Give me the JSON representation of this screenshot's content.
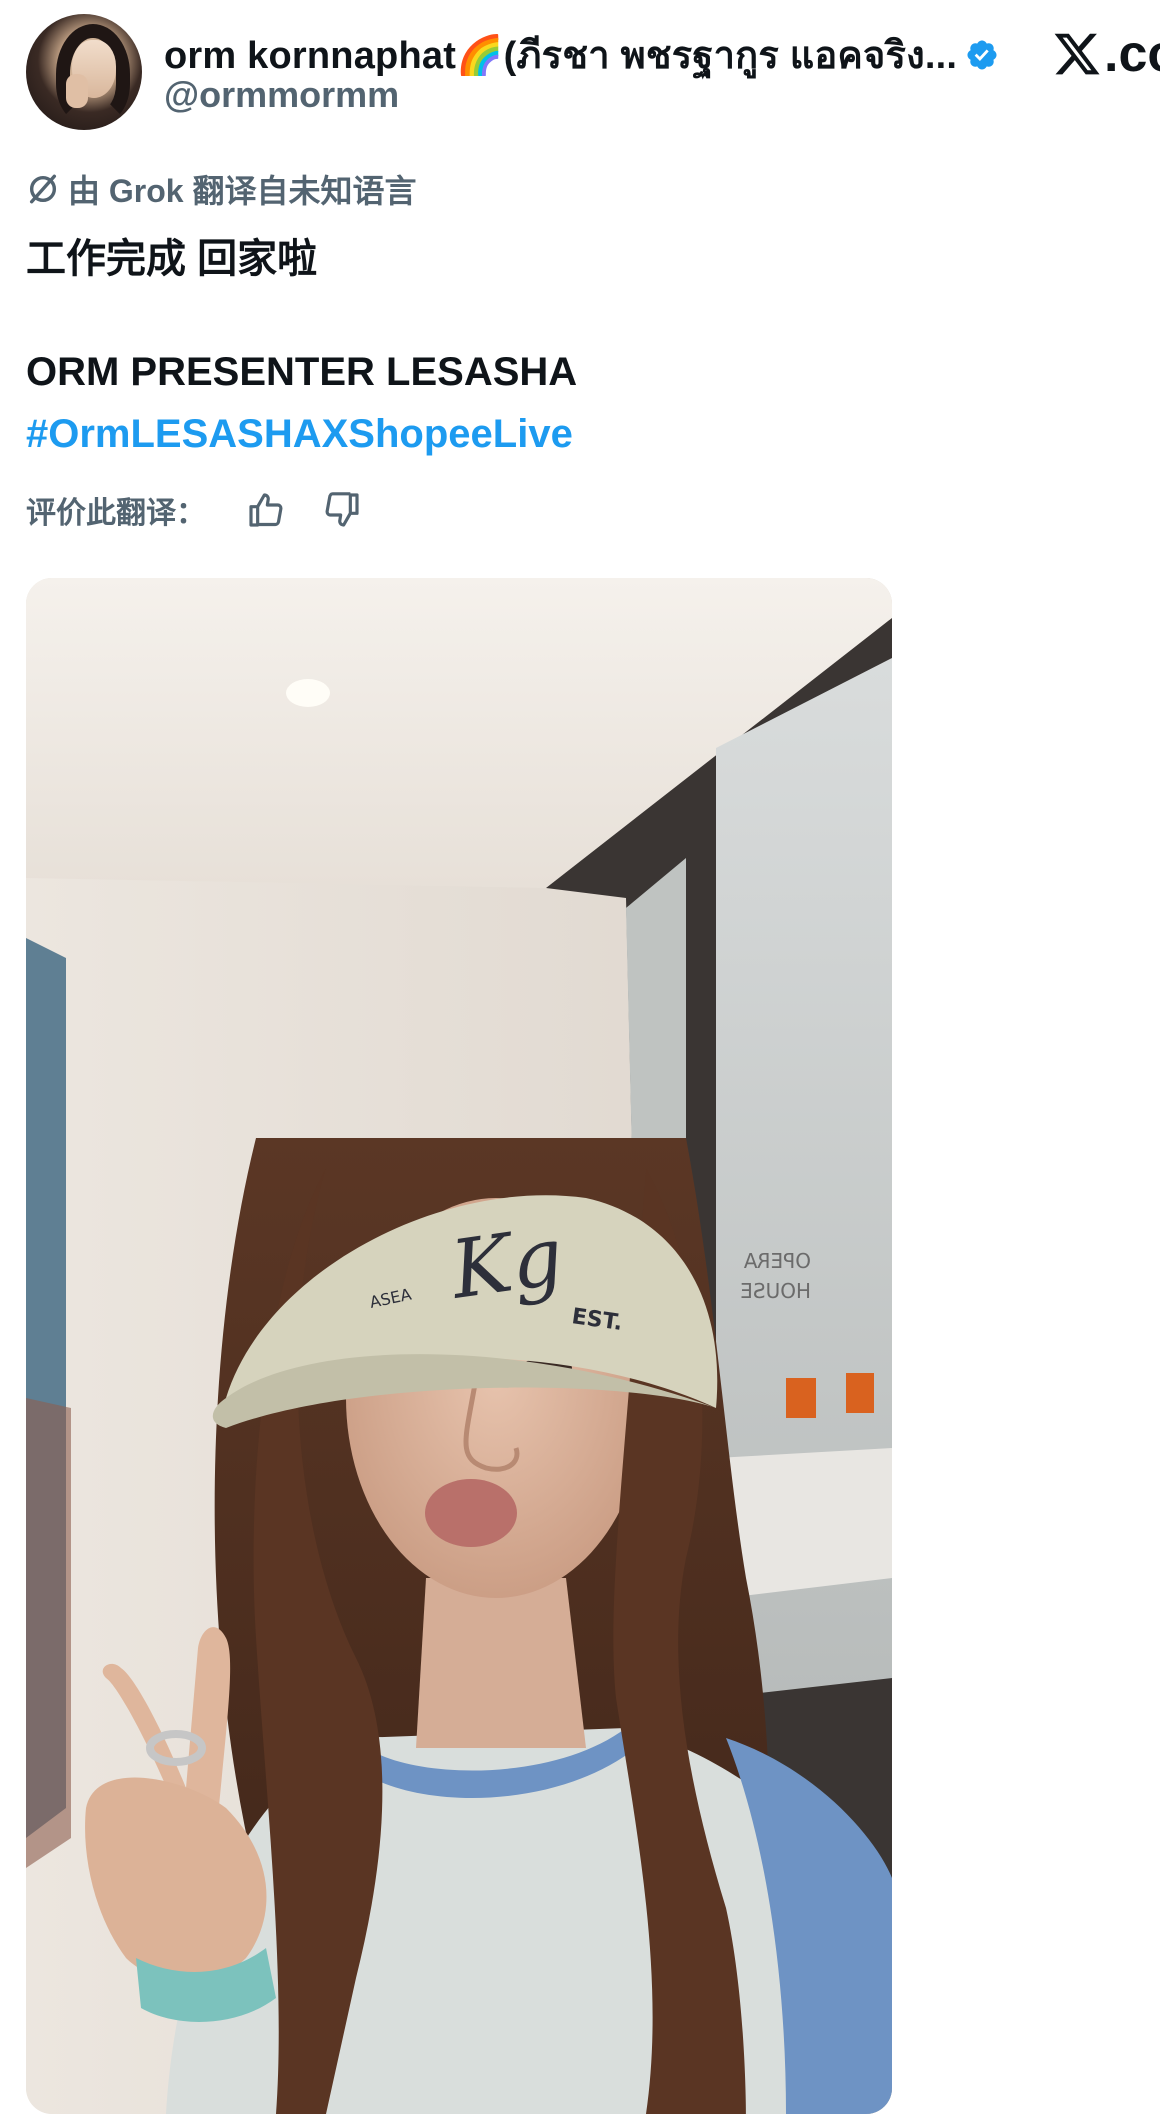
{
  "author": {
    "display_name": "orm kornnaphat🌈(ภีรชา พชรฐากูร แอคจริง...",
    "handle": "@ormmormm",
    "avatar_alt": "avatar",
    "verified_color": "#1d9bf0"
  },
  "brand": {
    "logo_text": ".co"
  },
  "translation": {
    "notice": "由 Grok 翻译自未知语言",
    "rate_label": "评价此翻译："
  },
  "tweet": {
    "line1": "工作完成 回家啦",
    "line2": "ORM PRESENTER LESASHA",
    "hashtag": "#OrmLESASHAXShopeeLive"
  },
  "photo": {
    "cap_logo": "Kg",
    "cap_small_left": "ASEA",
    "cap_small_right": "EST.",
    "glass_sign_1": "OPERA",
    "glass_sign_2": "HOUSE"
  },
  "colors": {
    "text_primary": "#0f1419",
    "text_secondary": "#536471",
    "link": "#1d9bf0"
  }
}
